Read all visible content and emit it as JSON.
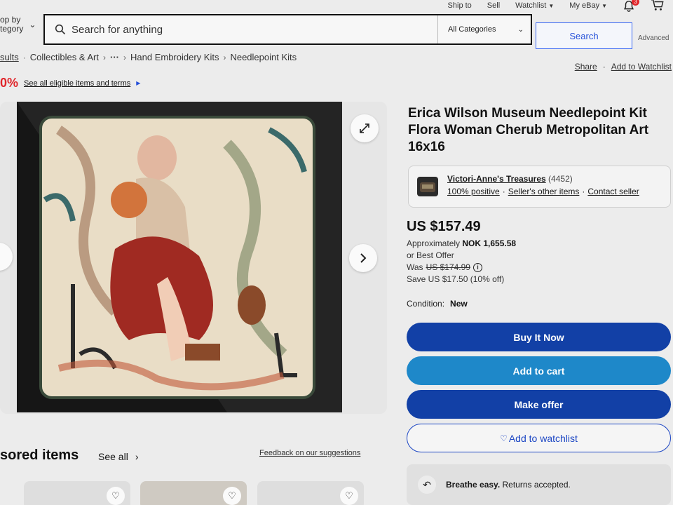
{
  "topnav": {
    "ship_to": "Ship to",
    "sell": "Sell",
    "watchlist": "Watchlist",
    "my_ebay": "My eBay",
    "notifications_count": "3"
  },
  "search": {
    "shop_by_line1": "op by",
    "shop_by_line2": "tegory",
    "placeholder": "Search for anything",
    "category": "All Categories",
    "button": "Search",
    "advanced": "Advanced"
  },
  "breadcrumb": {
    "results": "sults",
    "items": [
      "Collectibles & Art",
      "···",
      "Hand Embroidery Kits",
      "Needlepoint Kits"
    ]
  },
  "actions": {
    "share": "Share",
    "dot": "·",
    "add_to_watchlist": "Add to Watchlist"
  },
  "promo": {
    "percent": "0%",
    "terms": "See all eligible items and terms"
  },
  "listing": {
    "title": "Erica Wilson Museum Needlepoint Kit Flora Woman Cherub Metropolitan Art 16x16",
    "seller": {
      "name": "Victori-Anne's Treasures",
      "feedback_count": "(4452)",
      "positive": "100% positive",
      "other_items": "Seller's other items",
      "contact": "Contact seller"
    },
    "price": "US $157.49",
    "approx_label": "Approximately",
    "approx_value": "NOK 1,655.58",
    "best_offer": "or Best Offer",
    "was_label": "Was",
    "was_price": "US $174.99",
    "save": "Save US $17.50 (10% off)",
    "condition_label": "Condition:",
    "condition_value": "New",
    "buy_now": "Buy It Now",
    "add_to_cart": "Add to cart",
    "make_offer": "Make offer",
    "add_to_watchlist": "Add to watchlist",
    "returns_bold": "Breathe easy.",
    "returns_text": "Returns accepted."
  },
  "sponsored": {
    "heading": "sored items",
    "see_all": "See all",
    "feedback": "Feedback on our suggestions"
  },
  "colors": {
    "primary_blue": "#1240a6",
    "cart_blue": "#1e88c9",
    "link_blue": "#2550d9",
    "promo_red": "#e0262b"
  }
}
